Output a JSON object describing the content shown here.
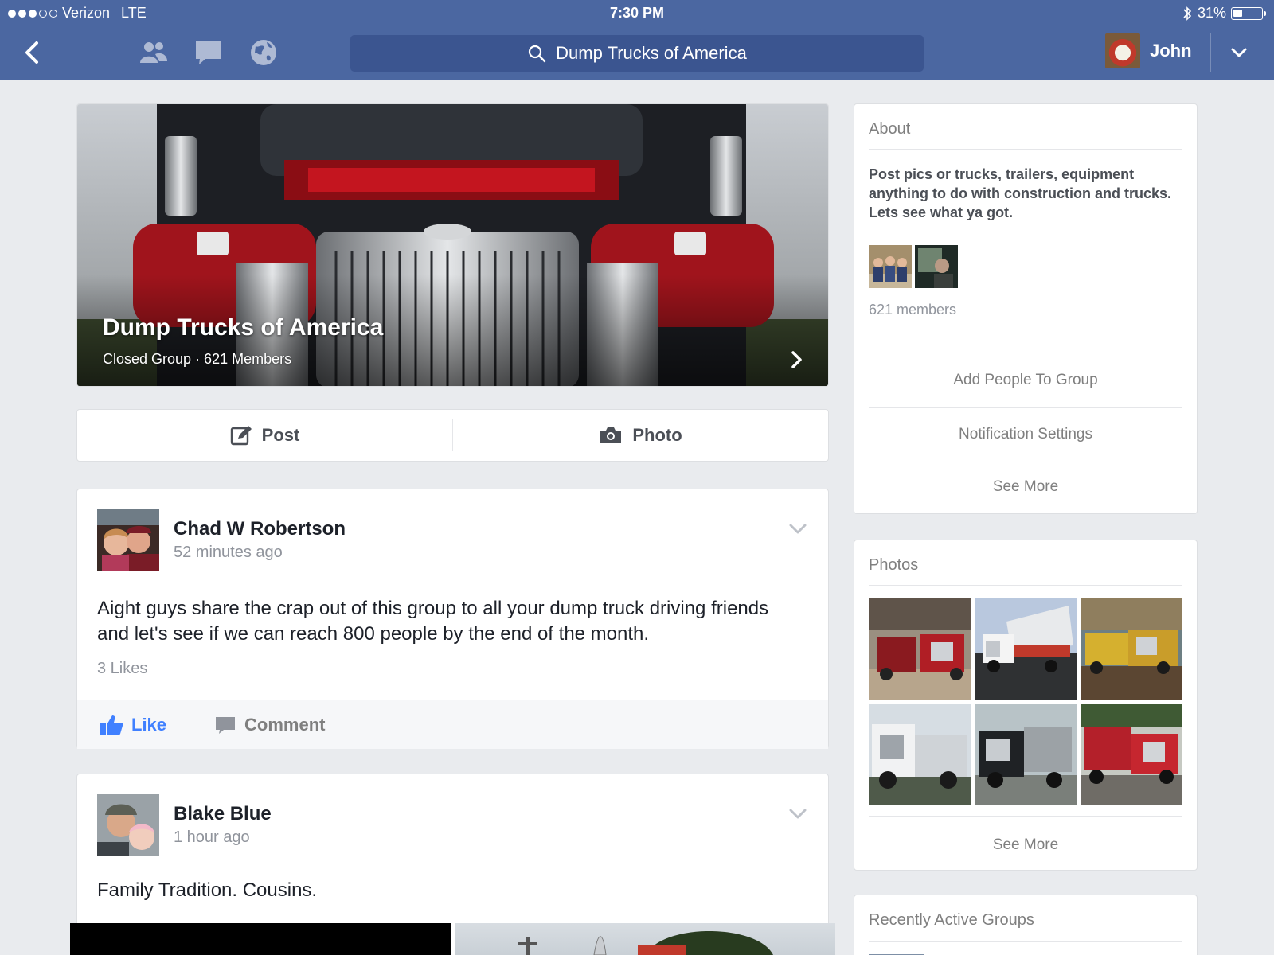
{
  "status_bar": {
    "carrier": "Verizon",
    "network": "LTE",
    "time": "7:30 PM",
    "battery_percent": "31%",
    "battery_level": 0.31
  },
  "nav": {
    "search_text": "Dump Trucks of America",
    "user_name": "John",
    "icons": [
      "back-chevron-icon",
      "friends-icon",
      "messages-icon",
      "globe-icon",
      "search-icon",
      "chevron-down-icon"
    ]
  },
  "group": {
    "name": "Dump Trucks of America",
    "subtitle": "Closed Group · 621 Members"
  },
  "composer": {
    "post_label": "Post",
    "photo_label": "Photo"
  },
  "posts": [
    {
      "author": "Chad W Robertson",
      "time": "52 minutes ago",
      "text": "Aight guys share the crap out of this group to all your dump truck driving friends and let's see if we can reach 800 people by the end of the month.",
      "likes": "3 Likes",
      "like_label": "Like",
      "comment_label": "Comment"
    },
    {
      "author": "Blake Blue",
      "time": "1 hour ago",
      "text": "Family Tradition. Cousins."
    }
  ],
  "about": {
    "heading": "About",
    "description": "Post pics or trucks, trailers, equipment anything to do with construction and trucks. Lets see what ya got.",
    "members": "621 members",
    "add_people": "Add People To Group",
    "notification_settings": "Notification Settings",
    "see_more": "See More"
  },
  "photos": {
    "heading": "Photos",
    "see_more": "See More"
  },
  "recent_groups": {
    "heading": "Recently Active Groups"
  },
  "colors": {
    "nav_blue": "#4b67a1",
    "search_blue": "#3b5590",
    "like_blue": "#4080ff",
    "background": "#e9ebee"
  }
}
